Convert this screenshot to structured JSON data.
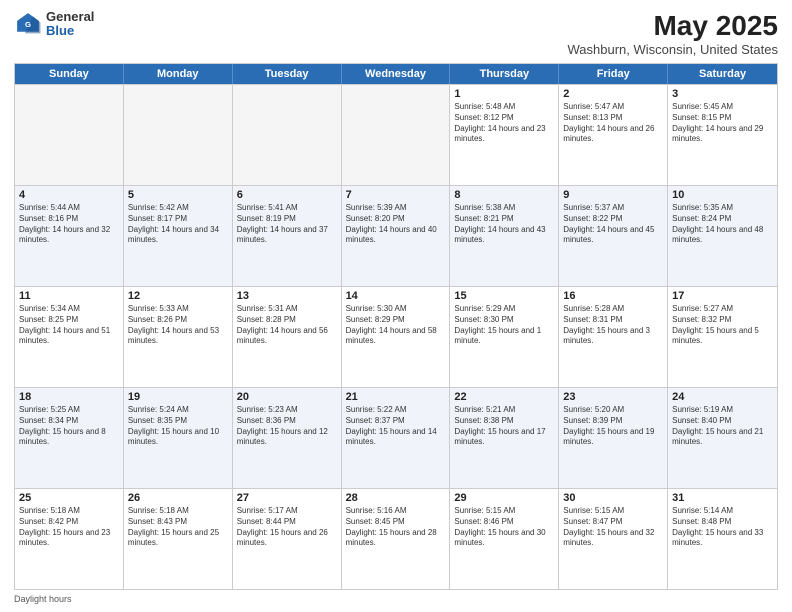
{
  "header": {
    "logo": {
      "general": "General",
      "blue": "Blue"
    },
    "title": "May 2025",
    "subtitle": "Washburn, Wisconsin, United States"
  },
  "days": [
    "Sunday",
    "Monday",
    "Tuesday",
    "Wednesday",
    "Thursday",
    "Friday",
    "Saturday"
  ],
  "rows": [
    [
      {
        "day": "",
        "sunrise": "",
        "sunset": "",
        "daylight": ""
      },
      {
        "day": "",
        "sunrise": "",
        "sunset": "",
        "daylight": ""
      },
      {
        "day": "",
        "sunrise": "",
        "sunset": "",
        "daylight": ""
      },
      {
        "day": "",
        "sunrise": "",
        "sunset": "",
        "daylight": ""
      },
      {
        "day": "1",
        "sunrise": "Sunrise: 5:48 AM",
        "sunset": "Sunset: 8:12 PM",
        "daylight": "Daylight: 14 hours and 23 minutes."
      },
      {
        "day": "2",
        "sunrise": "Sunrise: 5:47 AM",
        "sunset": "Sunset: 8:13 PM",
        "daylight": "Daylight: 14 hours and 26 minutes."
      },
      {
        "day": "3",
        "sunrise": "Sunrise: 5:45 AM",
        "sunset": "Sunset: 8:15 PM",
        "daylight": "Daylight: 14 hours and 29 minutes."
      }
    ],
    [
      {
        "day": "4",
        "sunrise": "Sunrise: 5:44 AM",
        "sunset": "Sunset: 8:16 PM",
        "daylight": "Daylight: 14 hours and 32 minutes."
      },
      {
        "day": "5",
        "sunrise": "Sunrise: 5:42 AM",
        "sunset": "Sunset: 8:17 PM",
        "daylight": "Daylight: 14 hours and 34 minutes."
      },
      {
        "day": "6",
        "sunrise": "Sunrise: 5:41 AM",
        "sunset": "Sunset: 8:19 PM",
        "daylight": "Daylight: 14 hours and 37 minutes."
      },
      {
        "day": "7",
        "sunrise": "Sunrise: 5:39 AM",
        "sunset": "Sunset: 8:20 PM",
        "daylight": "Daylight: 14 hours and 40 minutes."
      },
      {
        "day": "8",
        "sunrise": "Sunrise: 5:38 AM",
        "sunset": "Sunset: 8:21 PM",
        "daylight": "Daylight: 14 hours and 43 minutes."
      },
      {
        "day": "9",
        "sunrise": "Sunrise: 5:37 AM",
        "sunset": "Sunset: 8:22 PM",
        "daylight": "Daylight: 14 hours and 45 minutes."
      },
      {
        "day": "10",
        "sunrise": "Sunrise: 5:35 AM",
        "sunset": "Sunset: 8:24 PM",
        "daylight": "Daylight: 14 hours and 48 minutes."
      }
    ],
    [
      {
        "day": "11",
        "sunrise": "Sunrise: 5:34 AM",
        "sunset": "Sunset: 8:25 PM",
        "daylight": "Daylight: 14 hours and 51 minutes."
      },
      {
        "day": "12",
        "sunrise": "Sunrise: 5:33 AM",
        "sunset": "Sunset: 8:26 PM",
        "daylight": "Daylight: 14 hours and 53 minutes."
      },
      {
        "day": "13",
        "sunrise": "Sunrise: 5:31 AM",
        "sunset": "Sunset: 8:28 PM",
        "daylight": "Daylight: 14 hours and 56 minutes."
      },
      {
        "day": "14",
        "sunrise": "Sunrise: 5:30 AM",
        "sunset": "Sunset: 8:29 PM",
        "daylight": "Daylight: 14 hours and 58 minutes."
      },
      {
        "day": "15",
        "sunrise": "Sunrise: 5:29 AM",
        "sunset": "Sunset: 8:30 PM",
        "daylight": "Daylight: 15 hours and 1 minute."
      },
      {
        "day": "16",
        "sunrise": "Sunrise: 5:28 AM",
        "sunset": "Sunset: 8:31 PM",
        "daylight": "Daylight: 15 hours and 3 minutes."
      },
      {
        "day": "17",
        "sunrise": "Sunrise: 5:27 AM",
        "sunset": "Sunset: 8:32 PM",
        "daylight": "Daylight: 15 hours and 5 minutes."
      }
    ],
    [
      {
        "day": "18",
        "sunrise": "Sunrise: 5:25 AM",
        "sunset": "Sunset: 8:34 PM",
        "daylight": "Daylight: 15 hours and 8 minutes."
      },
      {
        "day": "19",
        "sunrise": "Sunrise: 5:24 AM",
        "sunset": "Sunset: 8:35 PM",
        "daylight": "Daylight: 15 hours and 10 minutes."
      },
      {
        "day": "20",
        "sunrise": "Sunrise: 5:23 AM",
        "sunset": "Sunset: 8:36 PM",
        "daylight": "Daylight: 15 hours and 12 minutes."
      },
      {
        "day": "21",
        "sunrise": "Sunrise: 5:22 AM",
        "sunset": "Sunset: 8:37 PM",
        "daylight": "Daylight: 15 hours and 14 minutes."
      },
      {
        "day": "22",
        "sunrise": "Sunrise: 5:21 AM",
        "sunset": "Sunset: 8:38 PM",
        "daylight": "Daylight: 15 hours and 17 minutes."
      },
      {
        "day": "23",
        "sunrise": "Sunrise: 5:20 AM",
        "sunset": "Sunset: 8:39 PM",
        "daylight": "Daylight: 15 hours and 19 minutes."
      },
      {
        "day": "24",
        "sunrise": "Sunrise: 5:19 AM",
        "sunset": "Sunset: 8:40 PM",
        "daylight": "Daylight: 15 hours and 21 minutes."
      }
    ],
    [
      {
        "day": "25",
        "sunrise": "Sunrise: 5:18 AM",
        "sunset": "Sunset: 8:42 PM",
        "daylight": "Daylight: 15 hours and 23 minutes."
      },
      {
        "day": "26",
        "sunrise": "Sunrise: 5:18 AM",
        "sunset": "Sunset: 8:43 PM",
        "daylight": "Daylight: 15 hours and 25 minutes."
      },
      {
        "day": "27",
        "sunrise": "Sunrise: 5:17 AM",
        "sunset": "Sunset: 8:44 PM",
        "daylight": "Daylight: 15 hours and 26 minutes."
      },
      {
        "day": "28",
        "sunrise": "Sunrise: 5:16 AM",
        "sunset": "Sunset: 8:45 PM",
        "daylight": "Daylight: 15 hours and 28 minutes."
      },
      {
        "day": "29",
        "sunrise": "Sunrise: 5:15 AM",
        "sunset": "Sunset: 8:46 PM",
        "daylight": "Daylight: 15 hours and 30 minutes."
      },
      {
        "day": "30",
        "sunrise": "Sunrise: 5:15 AM",
        "sunset": "Sunset: 8:47 PM",
        "daylight": "Daylight: 15 hours and 32 minutes."
      },
      {
        "day": "31",
        "sunrise": "Sunrise: 5:14 AM",
        "sunset": "Sunset: 8:48 PM",
        "daylight": "Daylight: 15 hours and 33 minutes."
      }
    ]
  ],
  "footer": {
    "daylight_label": "Daylight hours"
  }
}
